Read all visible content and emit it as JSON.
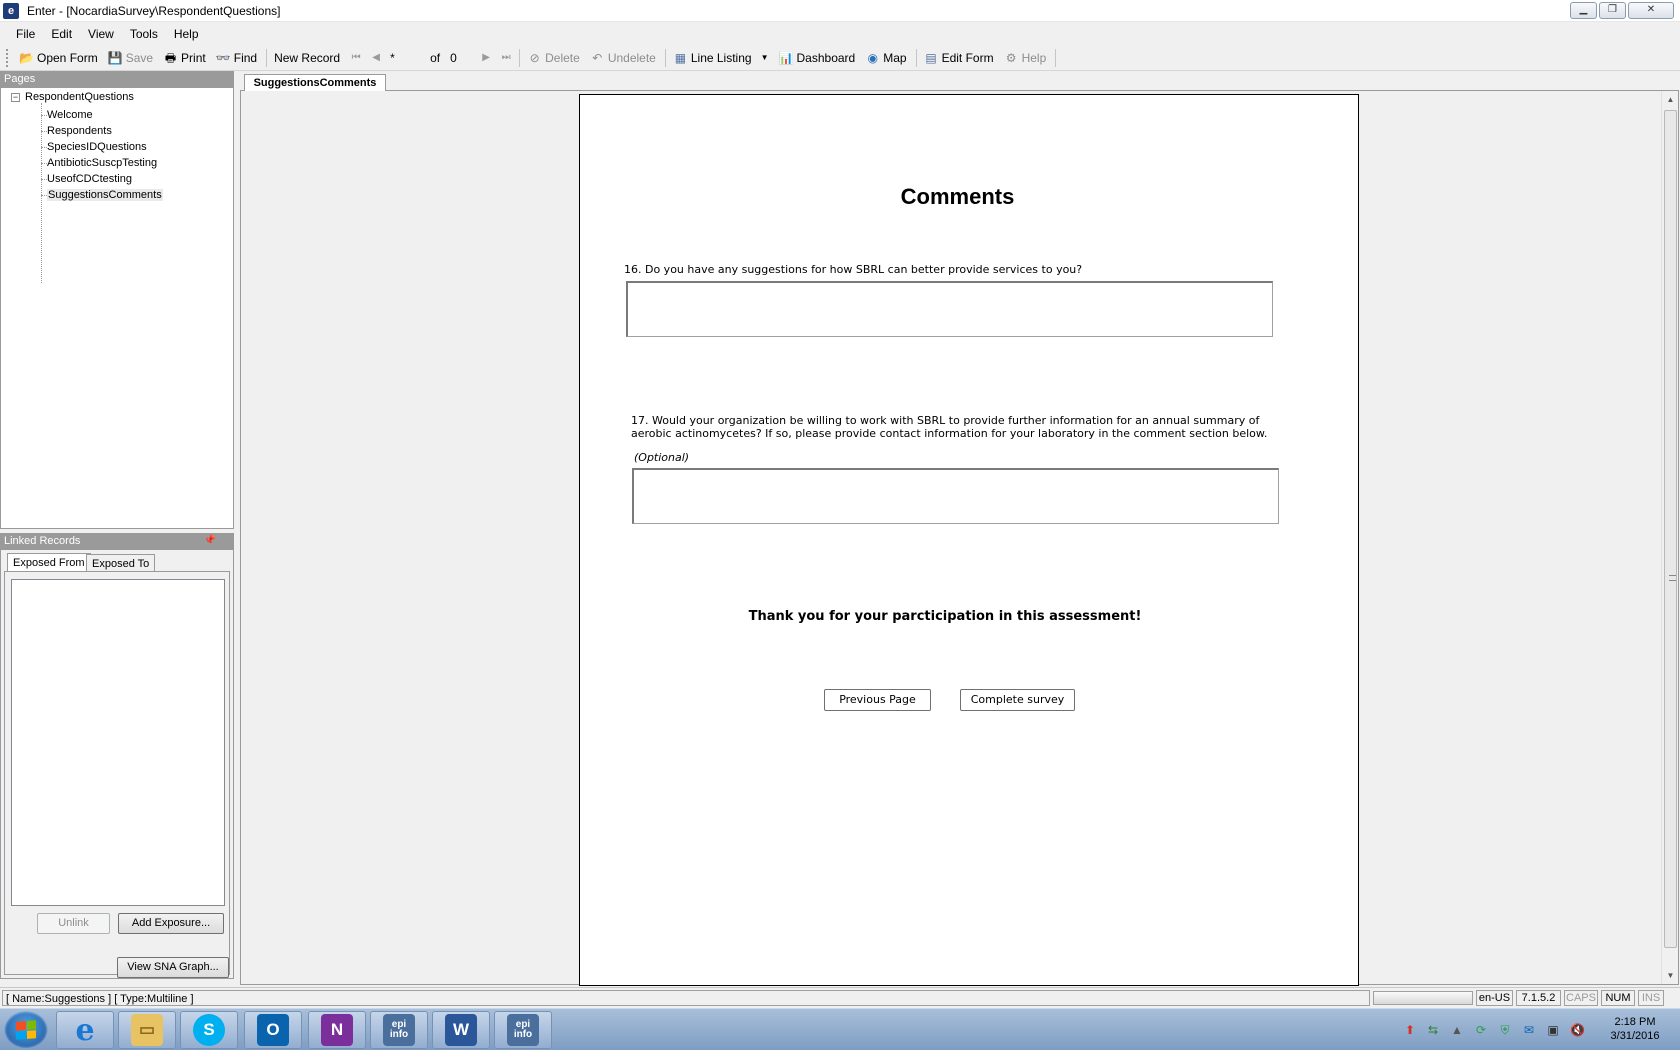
{
  "window": {
    "title": "Enter - [NocardiaSurvey\\RespondentQuestions]",
    "app_icon": "e"
  },
  "menu": [
    "File",
    "Edit",
    "View",
    "Tools",
    "Help"
  ],
  "toolbar": {
    "open_form": "Open Form",
    "save": "Save",
    "print": "Print",
    "find": "Find",
    "new_record": "New Record",
    "record_value": "*",
    "of_label": "of",
    "record_count": "0",
    "delete": "Delete",
    "undelete": "Undelete",
    "line_listing": "Line Listing",
    "dashboard": "Dashboard",
    "map": "Map",
    "edit_form": "Edit Form",
    "help": "Help"
  },
  "pages_panel": {
    "header": "Pages",
    "root": "RespondentQuestions",
    "items": [
      "Welcome",
      "Respondents",
      "SpeciesIDQuestions",
      "AntibioticSuscpTesting",
      "UseofCDCtesting",
      "SuggestionsComments"
    ],
    "selected": "SuggestionsComments"
  },
  "linked_records": {
    "header": "Linked Records",
    "tabs": [
      "Exposed From",
      "Exposed To"
    ],
    "unlink": "Unlink",
    "add_exposure": "Add Exposure...",
    "view_sna": "View SNA Graph..."
  },
  "main_tab": "SuggestionsComments",
  "form": {
    "title": "Comments",
    "q16": "16. Do you have any suggestions for how SBRL can better provide services to you?",
    "q17_line1": "17. Would your organization be willing to work with SBRL to provide further information for an annual summary of",
    "q17_line2": "aerobic actinomycetes? If so, please provide contact information for your laboratory in the comment section below.",
    "q17_optional": "(Optional)",
    "thanks": "Thank you for your parcticipation in this assessment!",
    "prev_button": "Previous Page",
    "complete_button": "Complete survey"
  },
  "status": {
    "text": "[ Name:Suggestions ] [ Type:Multiline ]",
    "locale": "en-US",
    "version": "7.1.5.2",
    "caps": "CAPS",
    "num": "NUM",
    "ins": "INS"
  },
  "taskbar": {
    "apps": [
      "internet-explorer",
      "file-explorer",
      "skype",
      "outlook",
      "onenote",
      "epi-info",
      "word",
      "epi-info"
    ],
    "epi_label": "epi info",
    "time": "2:18 PM",
    "date": "3/31/2016"
  }
}
